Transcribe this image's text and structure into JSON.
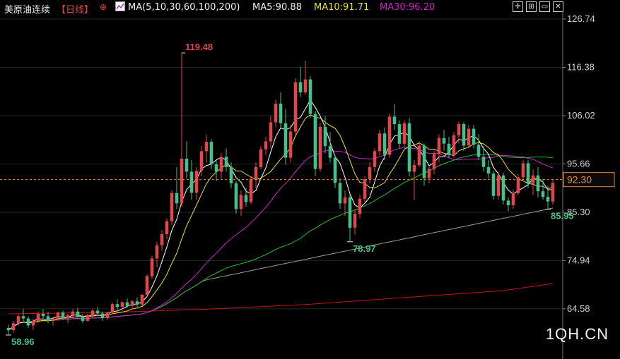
{
  "header": {
    "instrument": "美原油连续",
    "period": "【日线】",
    "settings_icon": "gear-icon",
    "ma_indicator_icon": "line-chart-icon",
    "ma_params": "MA(5,10,30,60,100,200)",
    "ma5": "MA5:90.88",
    "ma10": "MA10:91.71",
    "ma30": "MA30:96.20",
    "controls": [
      "crosshair-icon",
      "grid-icon",
      "window-icon",
      "close-icon"
    ]
  },
  "colors": {
    "background": "#000000",
    "up": "#e0474c",
    "down": "#45c08a",
    "ma5": "#ffffff",
    "ma10": "#e8e02f",
    "ma30": "#cc22cc",
    "ma60": "#22bb22",
    "ma100": "#9a9a9a",
    "ma200": "#cc1111",
    "grid": "#262626",
    "axis_text": "#d0d0d0",
    "current_price": "#e8883a"
  },
  "watermark": "1QH.CN",
  "chart_data": {
    "type": "candlestick",
    "title": "美原油连续 日线",
    "y_ticks": [
      126.74,
      116.38,
      106.02,
      95.66,
      85.3,
      74.94,
      64.58
    ],
    "ylim": [
      57.0,
      127.5
    ],
    "grid": true,
    "current_price": 92.3,
    "annotations": [
      {
        "label": "119.48",
        "value": 119.48,
        "type": "high"
      },
      {
        "label": "78.97",
        "value": 78.97,
        "type": "low"
      },
      {
        "label": "85.95",
        "value": 85.95,
        "type": "low"
      },
      {
        "label": "58.96",
        "value": 58.96,
        "type": "low"
      }
    ],
    "candles": [
      [
        60.5,
        61.2,
        59.0,
        60.0
      ],
      [
        60.0,
        62.0,
        59.5,
        61.5
      ],
      [
        61.5,
        63.5,
        61.0,
        63.0
      ],
      [
        63.0,
        64.5,
        62.0,
        62.5
      ],
      [
        62.5,
        63.0,
        60.5,
        61.0
      ],
      [
        61.0,
        62.5,
        60.0,
        62.0
      ],
      [
        62.0,
        64.0,
        61.5,
        63.5
      ],
      [
        63.5,
        64.5,
        62.5,
        63.0
      ],
      [
        63.0,
        64.0,
        61.5,
        62.0
      ],
      [
        62.0,
        62.8,
        61.0,
        62.5
      ],
      [
        62.5,
        64.0,
        62.0,
        63.8
      ],
      [
        63.8,
        64.2,
        62.2,
        62.5
      ],
      [
        62.5,
        63.5,
        61.5,
        63.2
      ],
      [
        63.2,
        64.5,
        62.8,
        64.0
      ],
      [
        64.0,
        64.8,
        62.5,
        63.0
      ],
      [
        63.0,
        63.5,
        61.5,
        62.0
      ],
      [
        62.0,
        63.5,
        61.8,
        63.2
      ],
      [
        63.2,
        64.5,
        62.5,
        64.2
      ],
      [
        64.2,
        65.0,
        63.2,
        63.6
      ],
      [
        63.6,
        64.0,
        62.0,
        62.6
      ],
      [
        62.6,
        64.0,
        62.2,
        63.8
      ],
      [
        63.8,
        66.0,
        63.5,
        65.6
      ],
      [
        65.6,
        66.6,
        64.4,
        65.0
      ],
      [
        65.0,
        66.2,
        64.2,
        66.0
      ],
      [
        66.0,
        66.8,
        64.8,
        65.2
      ],
      [
        65.2,
        66.5,
        64.4,
        66.2
      ],
      [
        66.2,
        67.0,
        65.0,
        65.5
      ],
      [
        65.5,
        67.8,
        65.2,
        67.6
      ],
      [
        67.6,
        72.0,
        67.2,
        71.6
      ],
      [
        71.6,
        76.0,
        71.0,
        75.4
      ],
      [
        75.4,
        79.0,
        73.5,
        78.2
      ],
      [
        78.2,
        81.5,
        77.0,
        80.6
      ],
      [
        80.6,
        84.0,
        79.5,
        83.4
      ],
      [
        83.4,
        90.0,
        82.5,
        89.4
      ],
      [
        89.4,
        95.0,
        86.0,
        87.2
      ],
      [
        87.2,
        119.48,
        86.5,
        96.8
      ],
      [
        96.8,
        100.5,
        92.5,
        94.0
      ],
      [
        94.0,
        96.5,
        88.0,
        89.5
      ],
      [
        89.5,
        95.0,
        88.0,
        94.2
      ],
      [
        94.2,
        99.5,
        93.0,
        98.4
      ],
      [
        98.4,
        102.0,
        96.0,
        100.4
      ],
      [
        100.4,
        101.0,
        94.5,
        95.6
      ],
      [
        95.6,
        96.5,
        92.0,
        94.0
      ],
      [
        94.0,
        98.0,
        92.5,
        97.2
      ],
      [
        97.2,
        99.0,
        94.0,
        95.0
      ],
      [
        95.0,
        96.0,
        90.5,
        91.5
      ],
      [
        91.5,
        92.0,
        85.0,
        86.0
      ],
      [
        86.0,
        90.0,
        84.5,
        89.0
      ],
      [
        89.0,
        90.5,
        86.5,
        87.5
      ],
      [
        87.5,
        93.0,
        87.0,
        92.4
      ],
      [
        92.4,
        96.0,
        90.5,
        95.0
      ],
      [
        95.0,
        99.5,
        94.5,
        98.8
      ],
      [
        98.8,
        101.5,
        97.5,
        100.5
      ],
      [
        100.5,
        106.0,
        99.0,
        104.6
      ],
      [
        104.6,
        109.5,
        103.5,
        108.6
      ],
      [
        108.6,
        111.0,
        103.5,
        104.4
      ],
      [
        104.4,
        107.5,
        95.5,
        97.0
      ],
      [
        97.0,
        104.0,
        96.0,
        102.6
      ],
      [
        102.6,
        114.0,
        102.0,
        113.2
      ],
      [
        113.2,
        116.5,
        110.0,
        111.0
      ],
      [
        111.0,
        117.8,
        110.5,
        113.8
      ],
      [
        113.8,
        114.5,
        105.5,
        106.4
      ],
      [
        106.4,
        107.0,
        93.0,
        94.6
      ],
      [
        94.6,
        104.5,
        94.0,
        103.6
      ],
      [
        103.6,
        106.0,
        98.0,
        99.5
      ],
      [
        99.5,
        102.5,
        96.0,
        97.0
      ],
      [
        97.0,
        97.5,
        90.5,
        91.6
      ],
      [
        91.6,
        92.5,
        86.0,
        87.2
      ],
      [
        87.2,
        90.0,
        84.5,
        88.5
      ],
      [
        88.5,
        89.0,
        78.97,
        82.0
      ],
      [
        82.0,
        86.0,
        80.5,
        85.0
      ],
      [
        85.0,
        89.0,
        84.0,
        88.2
      ],
      [
        88.2,
        93.0,
        87.5,
        92.4
      ],
      [
        92.4,
        96.0,
        91.5,
        95.0
      ],
      [
        95.0,
        99.0,
        94.0,
        98.4
      ],
      [
        98.4,
        103.0,
        97.5,
        102.2
      ],
      [
        102.2,
        103.5,
        96.5,
        97.6
      ],
      [
        97.6,
        106.5,
        97.0,
        105.8
      ],
      [
        105.8,
        108.5,
        103.0,
        104.2
      ],
      [
        104.2,
        105.0,
        99.0,
        100.0
      ],
      [
        100.0,
        105.0,
        99.0,
        104.4
      ],
      [
        104.4,
        105.5,
        93.0,
        94.0
      ],
      [
        94.0,
        96.5,
        88.0,
        95.4
      ],
      [
        95.4,
        100.5,
        95.0,
        99.6
      ],
      [
        99.6,
        100.0,
        91.0,
        92.6
      ],
      [
        92.6,
        95.0,
        91.5,
        94.6
      ],
      [
        94.6,
        98.5,
        93.5,
        97.8
      ],
      [
        97.8,
        102.0,
        96.0,
        101.2
      ],
      [
        101.2,
        103.0,
        98.5,
        100.0
      ],
      [
        100.0,
        101.5,
        97.0,
        97.6
      ],
      [
        97.6,
        102.5,
        97.0,
        101.8
      ],
      [
        101.8,
        104.8,
        100.0,
        104.2
      ],
      [
        104.2,
        104.6,
        98.5,
        99.6
      ],
      [
        99.6,
        104.0,
        99.0,
        103.2
      ],
      [
        103.2,
        104.0,
        99.0,
        99.8
      ],
      [
        99.8,
        102.0,
        96.5,
        97.2
      ],
      [
        97.2,
        99.5,
        94.0,
        95.0
      ],
      [
        95.0,
        96.5,
        92.5,
        93.6
      ],
      [
        93.6,
        94.2,
        88.0,
        88.8
      ],
      [
        88.8,
        94.0,
        88.0,
        93.2
      ],
      [
        93.2,
        93.8,
        87.0,
        87.8
      ],
      [
        87.8,
        88.5,
        85.5,
        86.8
      ],
      [
        86.8,
        90.0,
        86.0,
        89.4
      ],
      [
        89.4,
        93.5,
        89.0,
        92.8
      ],
      [
        92.8,
        96.5,
        92.0,
        95.8
      ],
      [
        95.8,
        96.5,
        90.5,
        91.4
      ],
      [
        91.4,
        94.5,
        89.0,
        93.2
      ],
      [
        93.2,
        95.0,
        88.5,
        89.8
      ],
      [
        89.8,
        92.5,
        88.0,
        88.6
      ],
      [
        88.6,
        91.0,
        85.95,
        87.6
      ],
      [
        87.6,
        92.5,
        87.0,
        91.6
      ]
    ],
    "moving_averages": [
      {
        "name": "MA5",
        "value": 90.88
      },
      {
        "name": "MA10",
        "value": 91.71
      },
      {
        "name": "MA30",
        "value": 96.2
      },
      {
        "name": "MA60"
      },
      {
        "name": "MA100"
      },
      {
        "name": "MA200",
        "points": [
          [
            0,
            63.5
          ],
          [
            20,
            63.8
          ],
          [
            40,
            64.5
          ],
          [
            60,
            65.5
          ],
          [
            80,
            67.0
          ],
          [
            100,
            68.5
          ],
          [
            110,
            70.0
          ]
        ]
      }
    ]
  }
}
